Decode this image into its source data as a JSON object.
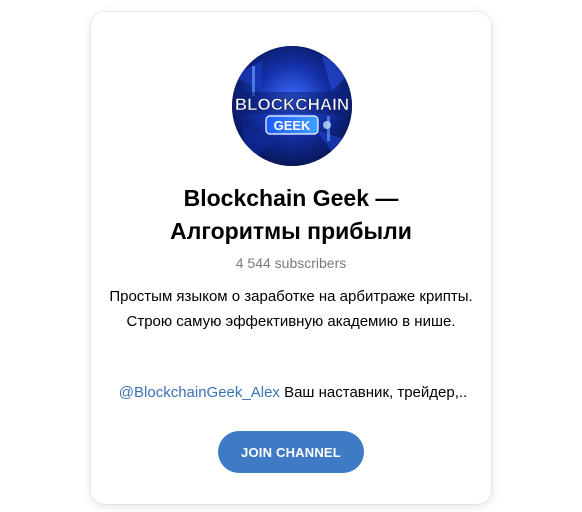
{
  "channel": {
    "avatar": {
      "line1": "BLOCKCHAIN",
      "line2": "GEEK"
    },
    "title": "Blockchain Geek — Алгоритмы прибыли",
    "subscribers": "4 544 subscribers",
    "description": "Простым языком о заработке на арбитраже крипты. Строю самую эффективную академию в нише.",
    "mention": "@BlockchainGeek_Alex",
    "mention_tail": " Ваш наставник, трейдер,.."
  },
  "actions": {
    "join_label": "JOIN CHANNEL"
  },
  "colors": {
    "accent": "#3f7bc4",
    "link": "#3a72b6",
    "muted": "#7a7a7a"
  }
}
